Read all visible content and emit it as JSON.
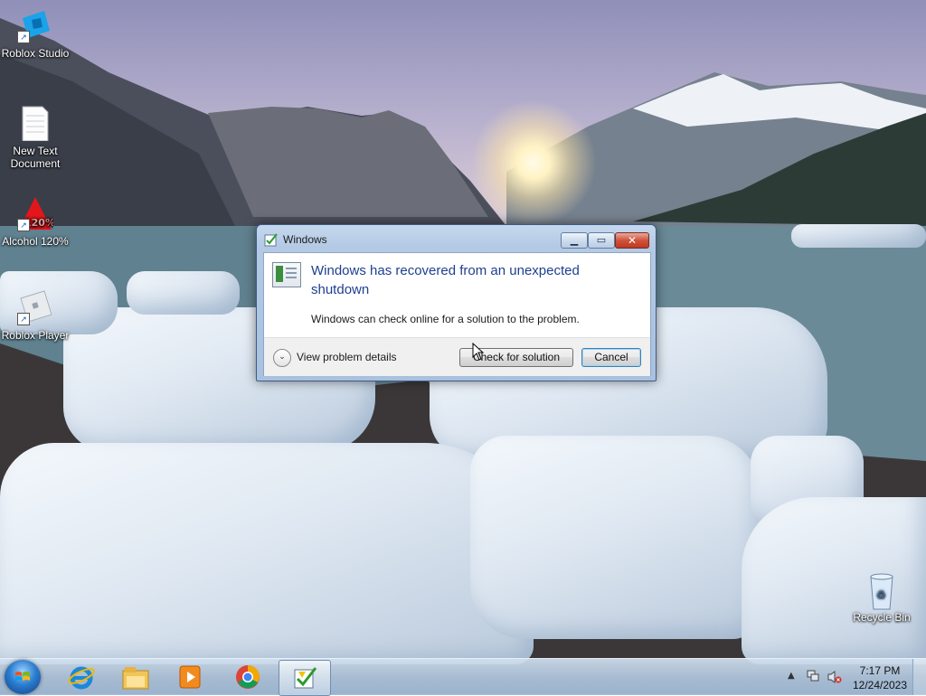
{
  "desktop": {
    "icons": [
      {
        "label": "Roblox Studio",
        "icon": "roblox-studio-icon"
      },
      {
        "label": "New Text\nDocument",
        "icon": "text-document-icon"
      },
      {
        "label": "Alcohol 120%",
        "icon": "alcohol-120-icon"
      },
      {
        "label": "Roblox Player",
        "icon": "roblox-player-icon"
      },
      {
        "label": "Recycle Bin",
        "icon": "recycle-bin-icon"
      }
    ]
  },
  "dialog": {
    "title": "Windows",
    "title_icon": "windows-error-report-icon",
    "main_instruction": "Windows has recovered from an unexpected shutdown",
    "body": "Windows can check online for a solution to the problem.",
    "details_label": "View problem details",
    "check_button": "Check for solution",
    "cancel_button": "Cancel",
    "close_symbol": "✕",
    "maximize_symbol": "▭",
    "minimize_symbol": "▁"
  },
  "taskbar": {
    "start": "windows-start-orb",
    "pinned": [
      "internet-explorer-icon",
      "file-explorer-icon",
      "media-player-icon",
      "chrome-icon",
      "windows-error-report-icon"
    ],
    "tray": {
      "time": "7:17 PM",
      "date": "12/24/2023",
      "icons": [
        "show-hidden-icons-arrow",
        "network-icon",
        "volume-muted-icon"
      ]
    }
  },
  "colors": {
    "instruction_text": "#1e3f8f",
    "close_button": "#c8452f",
    "taskbar": "#b2c8e0"
  }
}
